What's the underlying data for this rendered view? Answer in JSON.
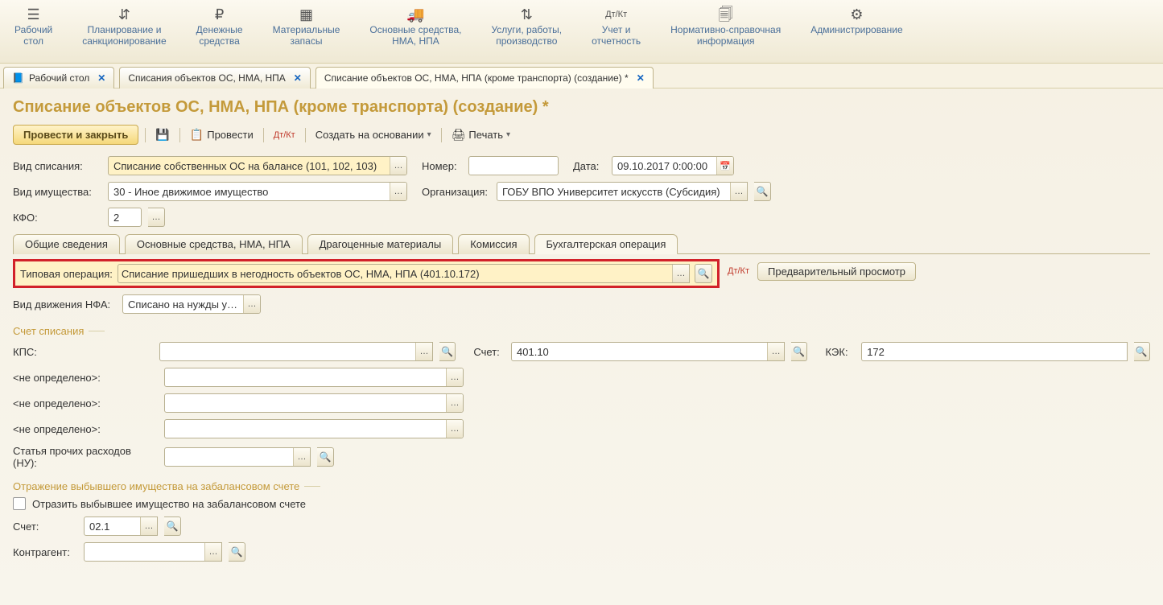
{
  "topnav": [
    {
      "icon": "☰",
      "label": "Рабочий\nстол"
    },
    {
      "icon": "⇵",
      "label": "Планирование и\nсанкционирование"
    },
    {
      "icon": "₽",
      "label": "Денежные\nсредства"
    },
    {
      "icon": "▦",
      "label": "Материальные\nзапасы"
    },
    {
      "icon": "🚚",
      "label": "Основные средства,\nНМА, НПА"
    },
    {
      "icon": "⇅",
      "label": "Услуги, работы,\nпроизводство"
    },
    {
      "icon": "Дт/Кт",
      "label": "Учет и\nотчетность"
    },
    {
      "icon": "🗐",
      "label": "Нормативно-справочная\nинформация"
    },
    {
      "icon": "⚙",
      "label": "Администрирование"
    }
  ],
  "doctabs": [
    {
      "label": "Рабочий стол",
      "icon": "📘"
    },
    {
      "label": "Списания объектов ОС, НМА, НПА"
    },
    {
      "label": "Списание объектов ОС, НМА, НПА (кроме транспорта) (создание) *",
      "active": true
    }
  ],
  "page_title": "Списание объектов ОС, НМА, НПА (кроме транспорта) (создание) *",
  "toolbar": {
    "post_close": "Провести и закрыть",
    "post": "Провести",
    "create_based": "Создать на основании",
    "print": "Печать"
  },
  "fields": {
    "vid_spisaniya_label": "Вид списания:",
    "vid_spisaniya_value": "Списание собственных ОС на балансе (101, 102, 103)",
    "nomer_label": "Номер:",
    "nomer_value": "",
    "data_label": "Дата:",
    "data_value": "09.10.2017 0:00:00",
    "vid_imushestva_label": "Вид имущества:",
    "vid_imushestva_value": "30 - Иное движимое имущество",
    "org_label": "Организация:",
    "org_value": "ГОБУ ВПО Университет искусств (Субсидия)",
    "kfo_label": "КФО:",
    "kfo_value": "2"
  },
  "inner_tabs": [
    "Общие сведения",
    "Основные средства, НМА, НПА",
    "Драгоценные материалы",
    "Комиссия",
    "Бухгалтерская операция"
  ],
  "inner_tab_active": 4,
  "typ_op_label": "Типовая операция:",
  "typ_op_value": "Списание пришедших в негодность объектов ОС, НМА, НПА (401.10.172)",
  "preview_btn": "Предварительный просмотр",
  "vid_dvizh_label": "Вид движения НФА:",
  "vid_dvizh_value": "Списано на нужды учреж",
  "group_schet": "Счет списания",
  "kps_label": "КПС:",
  "schet_label": "Счет:",
  "schet_value": "401.10",
  "kek_label": "КЭК:",
  "kek_value": "172",
  "undef": "<не определено>:",
  "statya_label": "Статья прочих расходов (НУ):",
  "group_zabal": "Отражение выбывшего имущества на забалансовом счете",
  "zabal_check_label": "Отразить выбывшее имущество на забалансовом счете",
  "schet2_label": "Счет:",
  "schet2_value": "02.1",
  "kontragent_label": "Контрагент:"
}
